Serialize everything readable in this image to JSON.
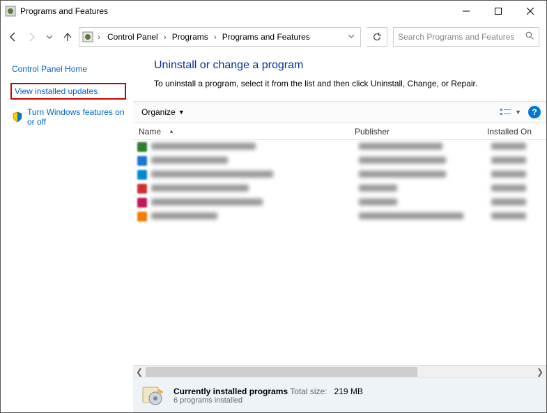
{
  "window": {
    "title": "Programs and Features"
  },
  "breadcrumb": {
    "items": [
      "Control Panel",
      "Programs",
      "Programs and Features"
    ]
  },
  "search": {
    "placeholder": "Search Programs and Features"
  },
  "sidebar": {
    "home": "Control Panel Home",
    "updates": "View installed updates",
    "features": "Turn Windows features on or off"
  },
  "main": {
    "heading": "Uninstall or change a program",
    "subtext": "To uninstall a program, select it from the list and then click Uninstall, Change, or Repair."
  },
  "toolbar": {
    "organize": "Organize"
  },
  "columns": {
    "name": "Name",
    "publisher": "Publisher",
    "installed": "Installed On"
  },
  "status": {
    "title": "Currently installed programs",
    "totalsize_label": "Total size:",
    "totalsize_value": "219 MB",
    "count": "6 programs installed"
  }
}
